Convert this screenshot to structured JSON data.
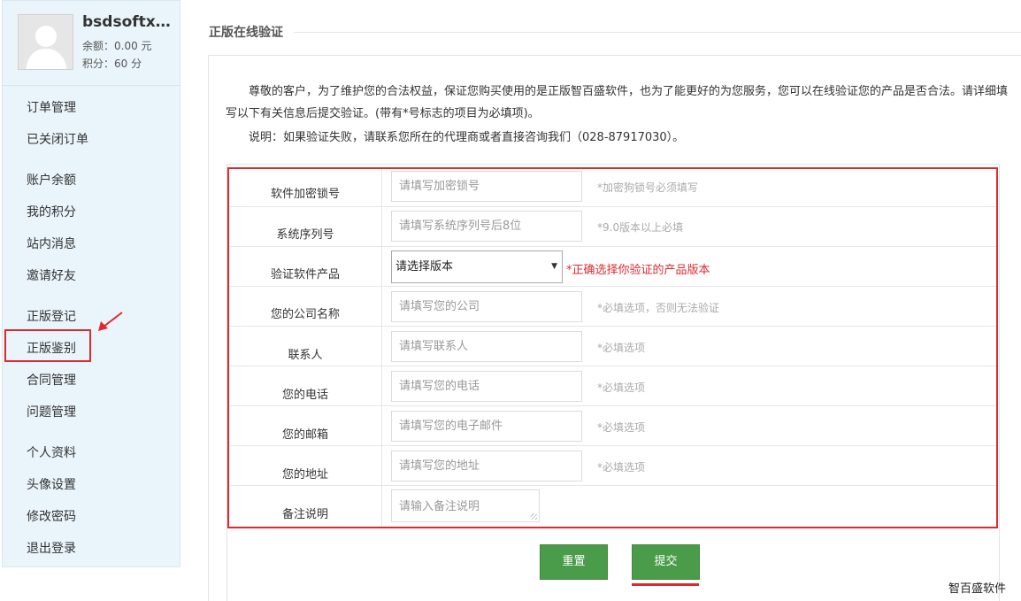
{
  "user": {
    "name": "bsdsoftxi...",
    "balance": "余额：0.00 元",
    "points": "积分：60 分"
  },
  "menu": [
    "订单管理",
    "已关闭订单",
    "账户余额",
    "我的积分",
    "站内消息",
    "邀请好友",
    "正版登记",
    "正版鉴别",
    "合同管理",
    "问题管理",
    "个人资料",
    "头像设置",
    "修改密码",
    "退出登录"
  ],
  "page": {
    "title": "正版在线验证",
    "intro": "尊敬的客户，为了维护您的合法权益，保证您购买使用的是正版智百盛软件，也为了能更好的为您服务，您可以在线验证您的产品是否合法。请详细填写以下有关信息后提交验证。(带有*号标志的项目为必填项)。",
    "note": "说明：如果验证失败，请联系您所在的代理商或者直接咨询我们（028-87917030）。"
  },
  "form": {
    "lock": {
      "label": "软件加密锁号",
      "placeholder": "请填写加密锁号",
      "hint": "*加密狗锁号必须填写"
    },
    "serial": {
      "label": "系统序列号",
      "placeholder": "请填写系统序列号后8位",
      "hint": "*9.0版本以上必填"
    },
    "product": {
      "label": "验证软件产品",
      "selected": "请选择版本",
      "hint": "*正确选择你验证的产品版本"
    },
    "company": {
      "label": "您的公司名称",
      "placeholder": "请填写您的公司",
      "hint": "*必填选项，否则无法验证"
    },
    "contact": {
      "label": "联系人",
      "placeholder": "请填写联系人",
      "hint": "*必填选项"
    },
    "phone": {
      "label": "您的电话",
      "placeholder": "请填写您的电话",
      "hint": "*必填选项"
    },
    "email": {
      "label": "您的邮箱",
      "placeholder": "请填写您的电子邮件",
      "hint": "*必填选项"
    },
    "address": {
      "label": "您的地址",
      "placeholder": "请填写您的地址",
      "hint": "*必填选项"
    },
    "remark": {
      "label": "备注说明",
      "placeholder": "请输入备注说明"
    }
  },
  "buttons": {
    "reset": "重置",
    "submit": "提交"
  },
  "watermark": "智百盛软件",
  "colors": {
    "highlight": "#e0292f",
    "button": "#4a9c4a",
    "sidebar": "#eaf5fb"
  }
}
